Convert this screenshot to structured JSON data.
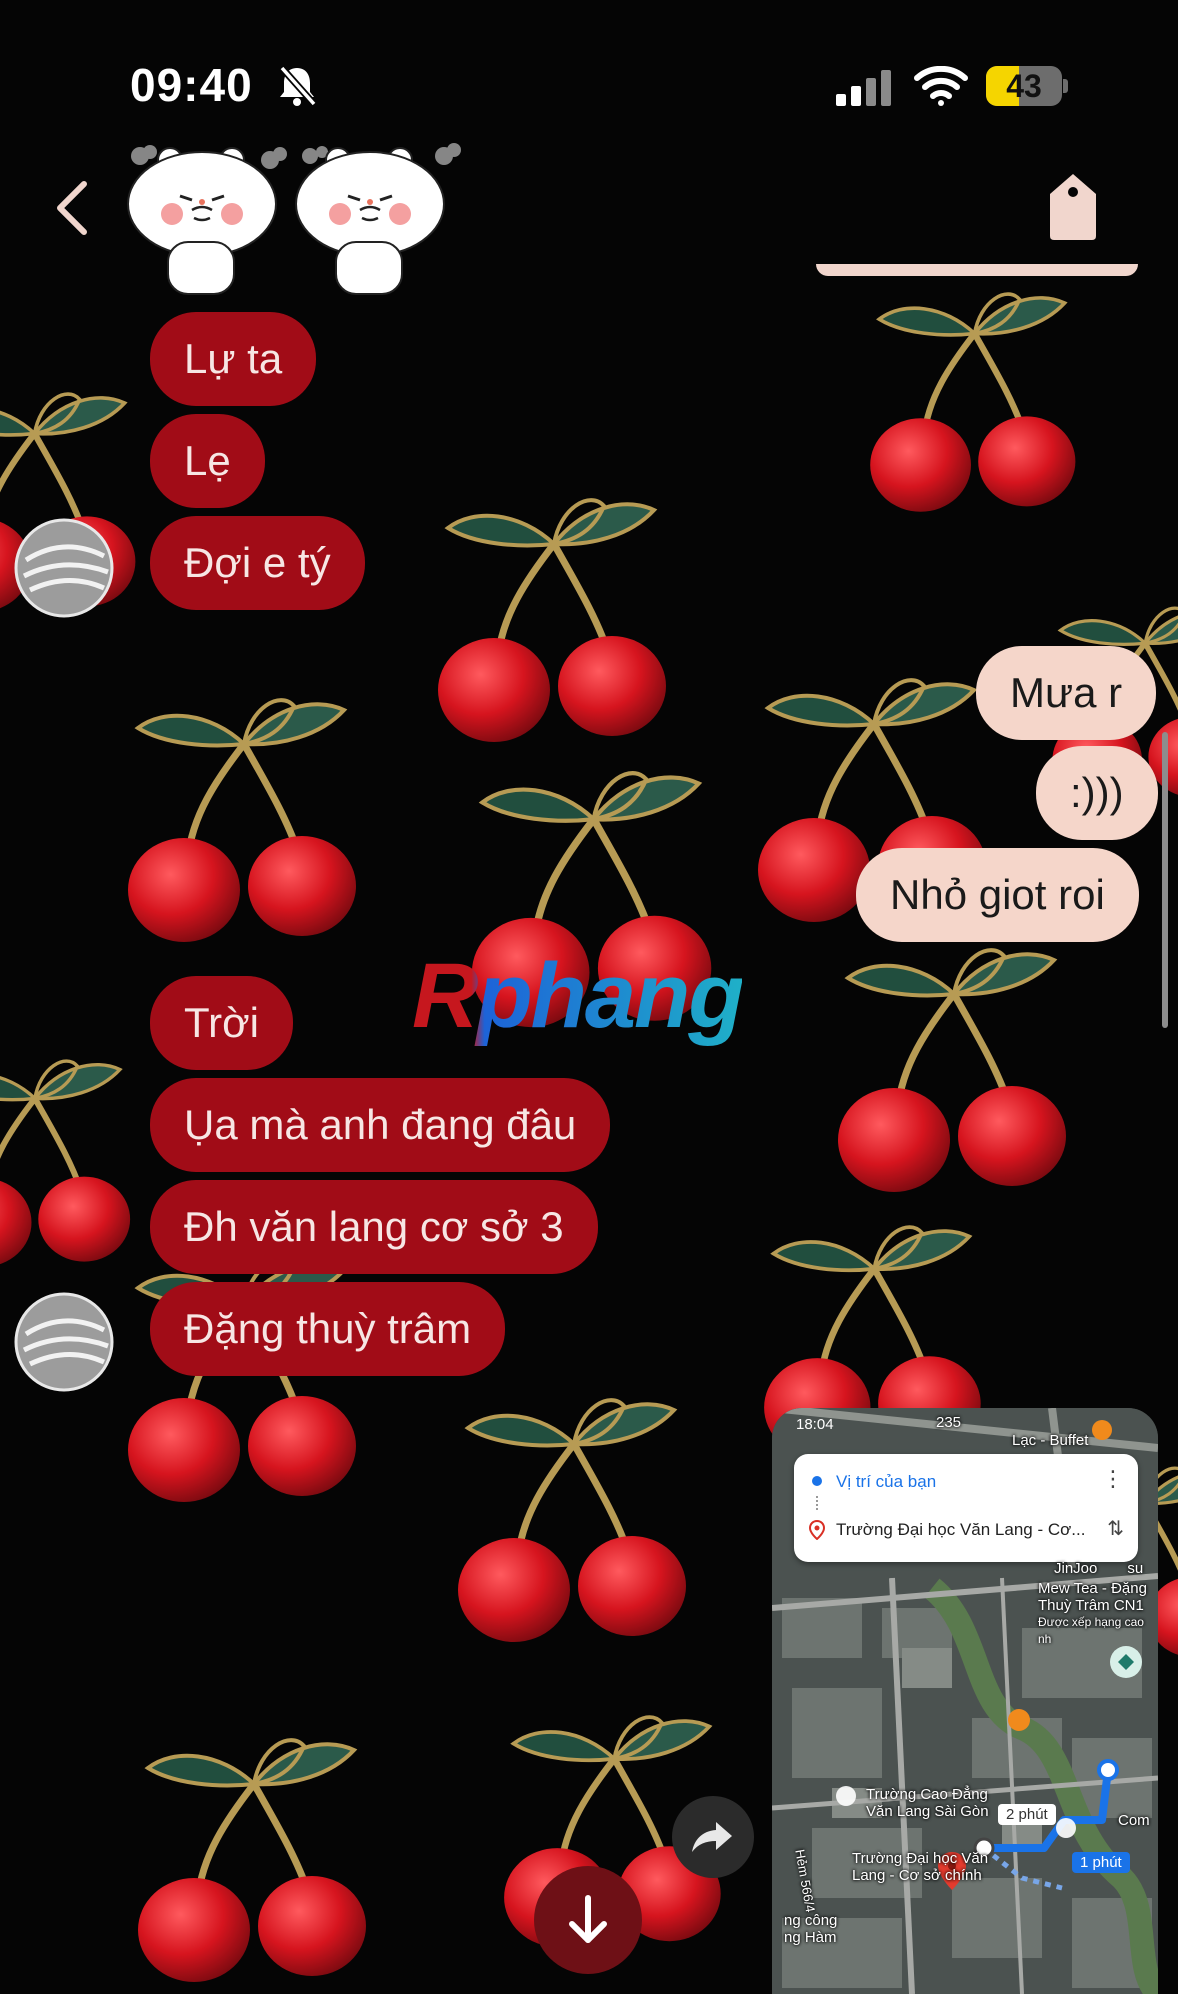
{
  "status_bar": {
    "time": "09:40",
    "battery": "43",
    "battery_level_percent": 43,
    "icons": [
      "bell-off-icon",
      "signal-icon",
      "wifi-icon",
      "battery-icon"
    ]
  },
  "header": {
    "back_icon": "chevron-left-icon",
    "avatar": "bear-sticker",
    "right_icon": "tag-icon"
  },
  "wallpaper": "cherry-pattern",
  "watermark": "Rphang",
  "colors": {
    "incoming_bubble": "#a10c17",
    "outgoing_bubble": "#f5d6ca",
    "background": "#050505",
    "accent_map": "#1a73e8"
  },
  "messages": {
    "group1": [
      "Lự ta",
      "Lẹ",
      "Đợi e tý"
    ],
    "group2": [
      "Mưa r",
      ":)))",
      "Nhỏ giot roi"
    ],
    "group3": [
      "Trời",
      "Ụa mà anh đang đâu",
      "Đh văn lang cơ sở 3",
      "Đặng thuỳ trâm"
    ]
  },
  "map_card": {
    "time": "18:04",
    "from": "Vị trí của bạn",
    "to": "Trường Đại học Văn Lang - Cơ...",
    "top_number": "235",
    "top_right": "Lạc - Buffet",
    "place1": "JinJoo",
    "place1_suffix": "su",
    "place2_line1": "Mew Tea - Đặng",
    "place2_line2": "Thuỳ Trâm CN1",
    "place2_note": "Được xếp hạng cao nh",
    "place3_line1": "Trường Cao Đẳng",
    "place3_line2": "Văn Lang Sài Gòn",
    "place4_line1": "Trường Đại học Văn",
    "place4_line2": "Lang - Cơ sở chính",
    "road_label": "Hẻm 566/4",
    "place5_line1": "ng công",
    "place5_line2": "ng Hàm",
    "place6": "Com",
    "route_alt": "2 phút",
    "route_main": "1 phút"
  },
  "buttons": {
    "share_icon": "share-arrow-icon",
    "scroll_icon": "arrow-down-icon"
  }
}
